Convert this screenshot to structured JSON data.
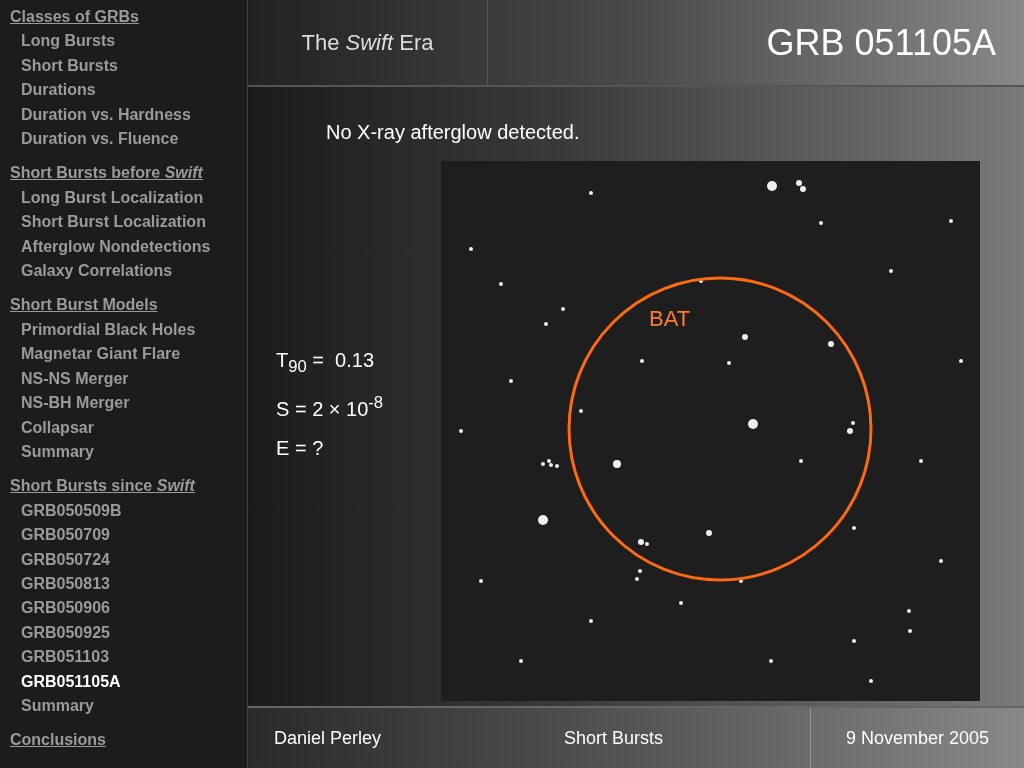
{
  "sidebar": {
    "sections": [
      {
        "heading": "Classes of GRBs",
        "items": [
          {
            "label": "Long Bursts",
            "selected": false
          },
          {
            "label": "Short Bursts",
            "selected": false
          },
          {
            "label": "Durations",
            "selected": false
          },
          {
            "label": "Duration vs. Hardness",
            "selected": false
          },
          {
            "label": "Duration vs. Fluence",
            "selected": false
          }
        ]
      },
      {
        "heading": "Short Bursts before *Swift*",
        "items": [
          {
            "label": "Long Burst Localization",
            "selected": false
          },
          {
            "label": "Short Burst Localization",
            "selected": false
          },
          {
            "label": "Afterglow Nondetections",
            "selected": false
          },
          {
            "label": "Galaxy Correlations",
            "selected": false
          }
        ]
      },
      {
        "heading": "Short Burst Models",
        "items": [
          {
            "label": "Primordial Black Holes",
            "selected": false
          },
          {
            "label": "Magnetar Giant Flare",
            "selected": false
          },
          {
            "label": "NS-NS Merger",
            "selected": false
          },
          {
            "label": "NS-BH Merger",
            "selected": false
          },
          {
            "label": "Collapsar",
            "selected": false
          },
          {
            "label": "Summary",
            "selected": false
          }
        ]
      },
      {
        "heading": "Short Bursts since *Swift*",
        "items": [
          {
            "label": "GRB050509B",
            "selected": false
          },
          {
            "label": "GRB050709",
            "selected": false
          },
          {
            "label": "GRB050724",
            "selected": false
          },
          {
            "label": "GRB050813",
            "selected": false
          },
          {
            "label": "GRB050906",
            "selected": false
          },
          {
            "label": "GRB050925",
            "selected": false
          },
          {
            "label": "GRB051103",
            "selected": false
          },
          {
            "label": "GRB051105A",
            "selected": true
          },
          {
            "label": "Summary",
            "selected": false
          }
        ]
      },
      {
        "heading": "Conclusions"
      }
    ]
  },
  "header": {
    "section_title": "The *Swift* Era",
    "slide_title": "GRB 051105A"
  },
  "content": {
    "caption": "No X-ray afterglow detected.",
    "stats": [
      "T$_{90}$ =  0.13",
      "S = 2 × 10$^{-8}$",
      "E = ?"
    ],
    "image_label": "BAT"
  },
  "footer": {
    "author": "Daniel Perley",
    "topic": "Short Bursts",
    "date": "9 November 2005"
  }
}
